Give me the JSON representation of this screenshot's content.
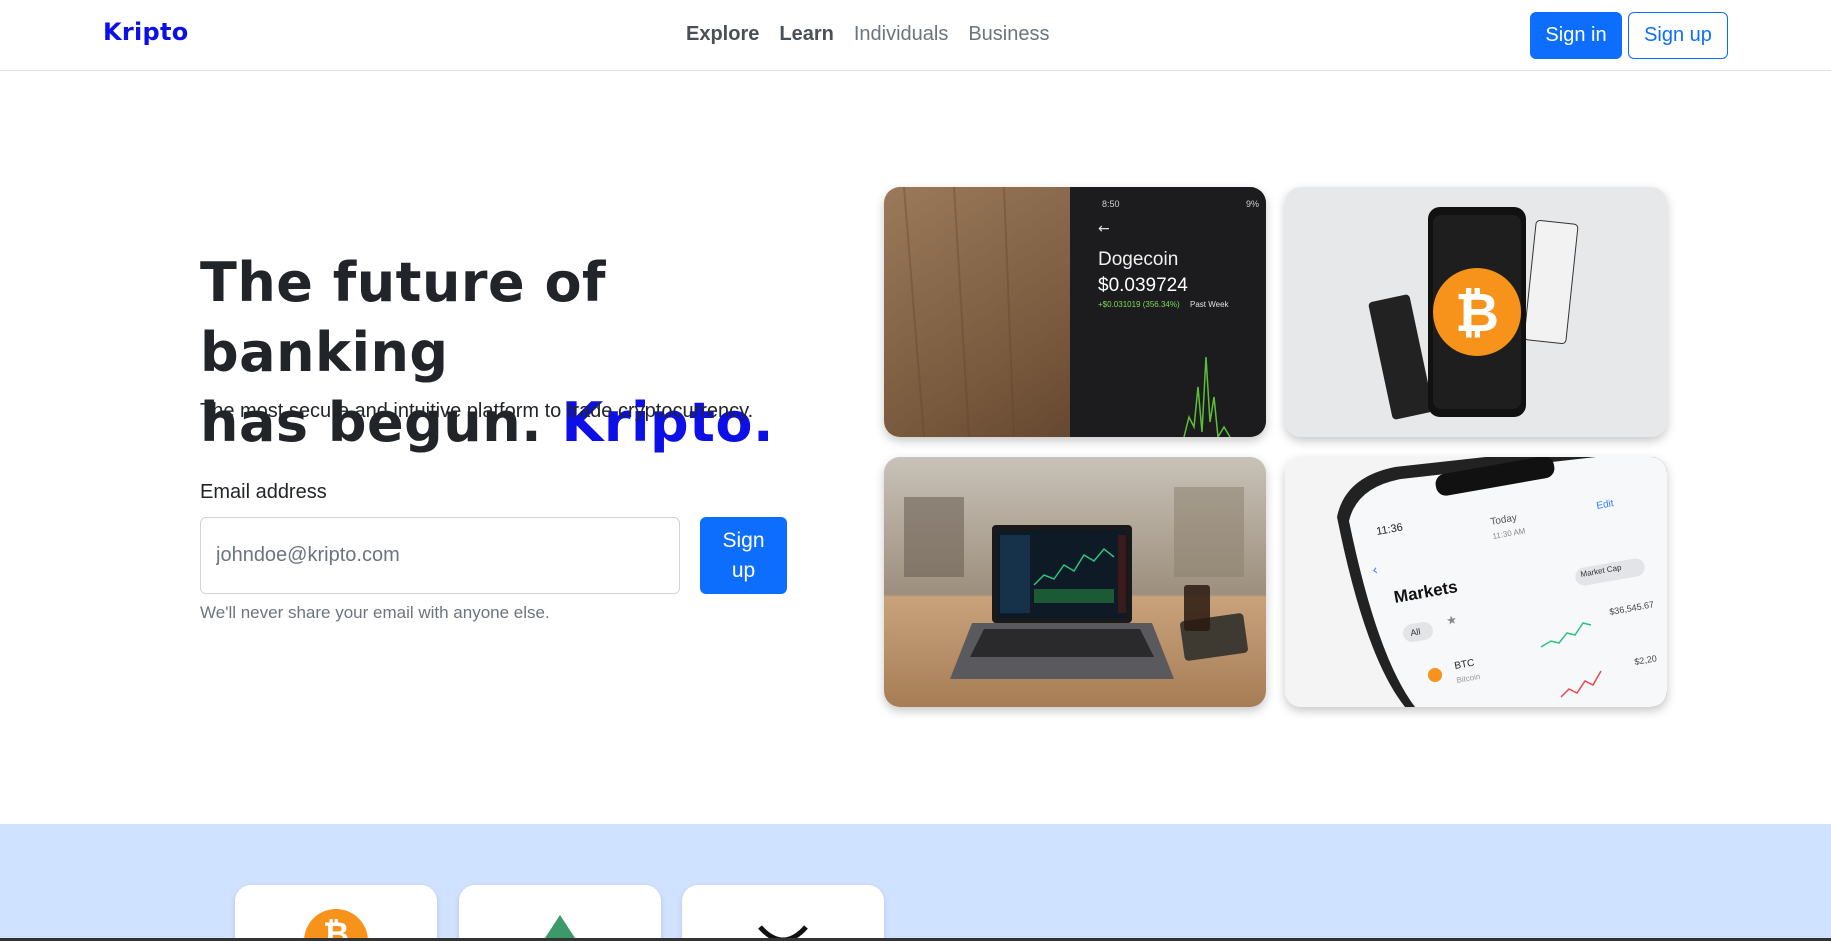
{
  "nav": {
    "brand": "Kripto",
    "links": [
      "Explore",
      "Learn",
      "Individuals",
      "Business"
    ],
    "signin_label": "Sign in",
    "signup_label": "Sign up"
  },
  "hero": {
    "title_line1": "The future of banking",
    "title_line2": "has begun. ",
    "title_accent": "Kripto.",
    "subtitle": "The most secure and intuitive platform to trade cryptocurrency.",
    "email_label": "Email address",
    "email_placeholder": "johndoe@kripto.com",
    "signup_line1": "Sign",
    "signup_line2": "up",
    "help_text": "We'll never share your email with anyone else."
  },
  "images": {
    "dogecoin": {
      "status_time": "8:50",
      "status_right": "9%",
      "coin_name": "Dogecoin",
      "price": "$0.039724",
      "change": "+$0.031019 (356.34%)",
      "period": "Past Week"
    },
    "markets": {
      "time": "11:36",
      "today": "Today",
      "today_time": "11:30 AM",
      "edit": "Edit",
      "title": "Markets",
      "filter": "Market Cap",
      "tab_all": "All",
      "coin": "BTC",
      "coin_full": "Bitcoin",
      "value1": "$36,545.67",
      "value2": "$2,20"
    }
  },
  "colors": {
    "brand": "#0d10e6",
    "primary": "#0d6efd",
    "band": "#cfe2ff"
  }
}
